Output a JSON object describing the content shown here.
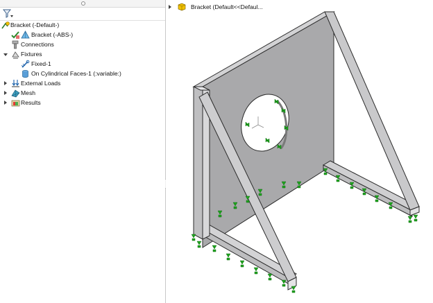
{
  "tree": {
    "root_label": "Bracket (-Default-)",
    "items": [
      {
        "label": "Bracket (-ABS-)"
      },
      {
        "label": "Connections"
      },
      {
        "label": "Fixtures"
      },
      {
        "label": "Fixed-1"
      },
      {
        "label": "On Cylindrical Faces-1 (:variable:)"
      },
      {
        "label": "External Loads"
      },
      {
        "label": "Mesh"
      },
      {
        "label": "Results"
      }
    ]
  },
  "viewport": {
    "breadcrumb_label": "Bracket  (Default<<Defaul..."
  },
  "colors": {
    "plate": "#a9a9ab",
    "beam_light": "#d6d6d8",
    "beam_mid": "#bdbdbf",
    "edge": "#2a2a2a",
    "fixture": "#1fa51f"
  }
}
